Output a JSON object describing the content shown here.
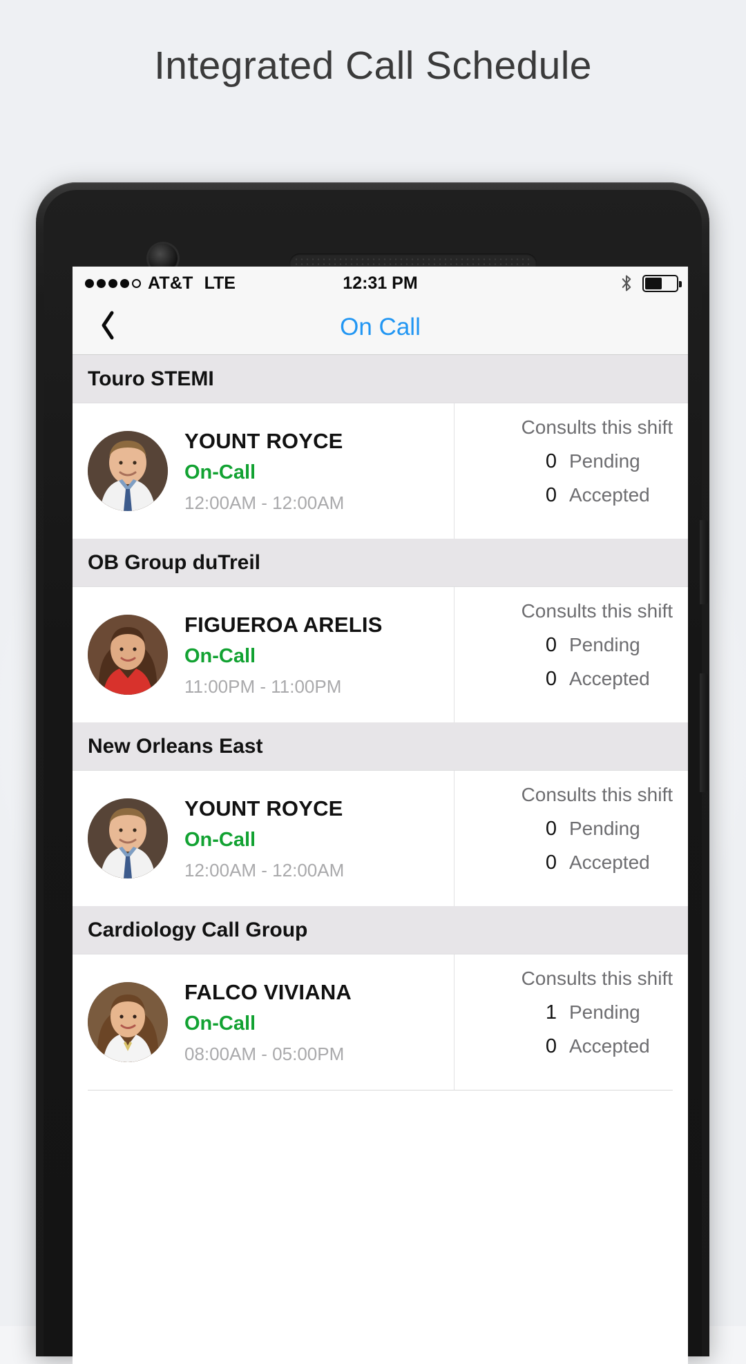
{
  "page": {
    "title": "Integrated Call Schedule",
    "background_color": "#f4f5f7"
  },
  "device": {
    "frame_color": "#191919",
    "camera": "front-camera",
    "speaker": "earpiece-speaker"
  },
  "status_bar": {
    "signal_dots_filled": 4,
    "signal_dots_total": 5,
    "carrier": "AT&T",
    "network": "LTE",
    "time": "12:31 PM",
    "bluetooth_icon": "bluetooth-icon",
    "battery_level_percent": 52
  },
  "nav_bar": {
    "back_icon": "chevron-left-icon",
    "title": "On Call",
    "title_color": "#2196f3"
  },
  "colors": {
    "section_header_bg": "#e7e5e8",
    "on_call_green": "#12a232",
    "accent_blue": "#2196f3",
    "time_gray": "#a9a9ab",
    "label_gray": "#6d6d70"
  },
  "sections": [
    {
      "group_name": "Touro STEMI",
      "entry": {
        "avatar": "avatar-photo-male",
        "name": "YOUNT ROYCE",
        "status": "On-Call",
        "shift_time": "12:00AM - 12:00AM",
        "consults_label": "Consults this shift",
        "pending_count": "0",
        "pending_label": "Pending",
        "accepted_count": "0",
        "accepted_label": "Accepted"
      }
    },
    {
      "group_name": "OB Group duTreil",
      "entry": {
        "avatar": "avatar-photo-female-red",
        "name": "FIGUEROA ARELIS",
        "status": "On-Call",
        "shift_time": "11:00PM - 11:00PM",
        "consults_label": "Consults this shift",
        "pending_count": "0",
        "pending_label": "Pending",
        "accepted_count": "0",
        "accepted_label": "Accepted"
      }
    },
    {
      "group_name": "New Orleans East",
      "entry": {
        "avatar": "avatar-photo-male",
        "name": "YOUNT ROYCE",
        "status": "On-Call",
        "shift_time": "12:00AM - 12:00AM",
        "consults_label": "Consults this shift",
        "pending_count": "0",
        "pending_label": "Pending",
        "accepted_count": "0",
        "accepted_label": "Accepted"
      }
    },
    {
      "group_name": "Cardiology Call Group",
      "entry": {
        "avatar": "avatar-photo-female-white",
        "name": "FALCO VIVIANA",
        "status": "On-Call",
        "shift_time": "08:00AM - 05:00PM",
        "consults_label": "Consults this shift",
        "pending_count": "1",
        "pending_label": "Pending",
        "accepted_count": "0",
        "accepted_label": "Accepted"
      }
    }
  ]
}
